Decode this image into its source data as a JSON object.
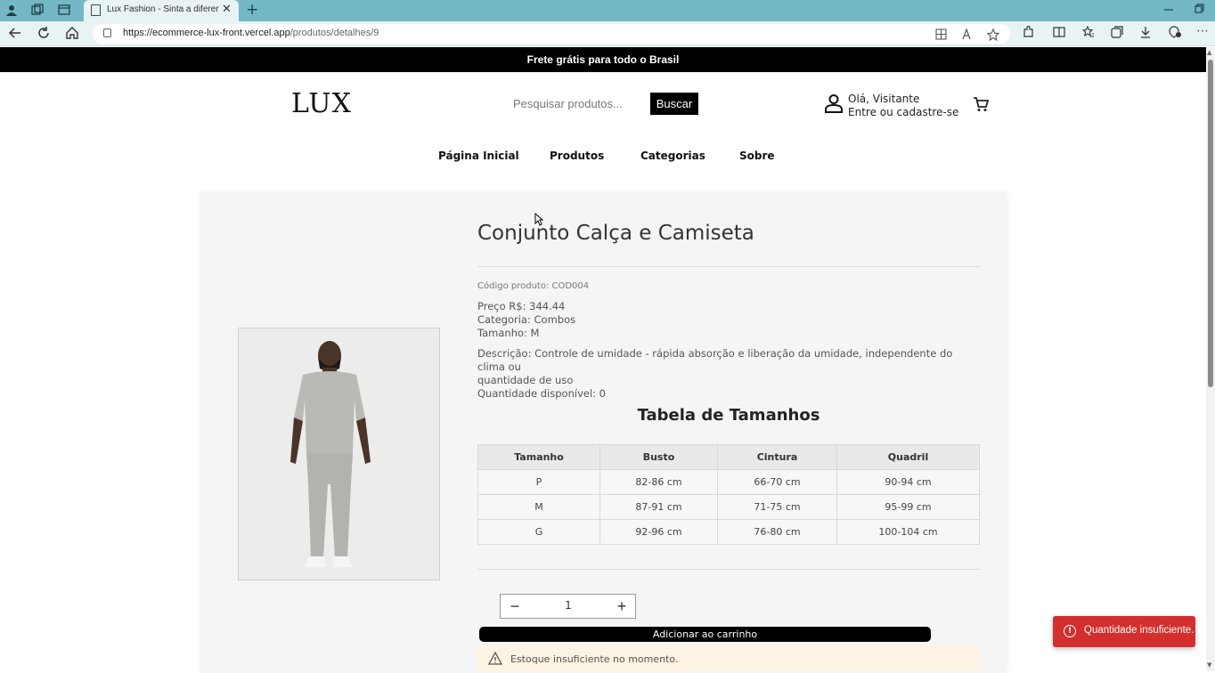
{
  "browser": {
    "tab_title": "Lux Fashion - Sinta a diferença de",
    "tab_close": "✕",
    "new_tab": "+",
    "url_host": "https://ecommerce-lux-front.vercel.app",
    "url_path": "/produtos/detalhes/9"
  },
  "promo_bar": {
    "text": "Frete grátis para todo o Brasil"
  },
  "header": {
    "logo": "LUX",
    "search_placeholder": "Pesquisar produtos...",
    "search_button": "Buscar",
    "greeting": "Olá, Visitante",
    "login_link": "Entre ou cadastre-se"
  },
  "nav": {
    "home": "Página Inicial",
    "products": "Produtos",
    "categories": "Categorias",
    "about": "Sobre"
  },
  "product": {
    "title": "Conjunto Calça e Camiseta",
    "code": "Código produto: COD004",
    "price": "Preço R$: 344.44",
    "category": "Categoria: Combos",
    "size": "Tamanho: M",
    "description_line1": "Descrição: Controle de umidade - rápida absorção e liberação da umidade, independente do clima ou",
    "description_line2": "quantidade de uso",
    "stock": "Quantidade disponível: 0"
  },
  "size_table": {
    "title": "Tabela de Tamanhos",
    "headers": [
      "Tamanho",
      "Busto",
      "Cintura",
      "Quadril"
    ],
    "rows": [
      [
        "P",
        "82-86 cm",
        "66-70 cm",
        "90-94 cm"
      ],
      [
        "M",
        "87-91 cm",
        "71-75 cm",
        "95-99 cm"
      ],
      [
        "G",
        "92-96 cm",
        "76-80 cm",
        "100-104 cm"
      ]
    ]
  },
  "purchase": {
    "minus": "−",
    "quantity": "1",
    "plus": "+",
    "add_to_cart": "Adicionar ao carrinho",
    "warning": "Estoque insuficiente no momento."
  },
  "toast": {
    "icon": "!",
    "message": "Quantidade insuficiente."
  },
  "colors": {
    "promo_bg": "#000000",
    "tab_bar": "#74b7c5",
    "toast_bg": "#d32f2f",
    "warning_bg": "#fdf3e2"
  }
}
